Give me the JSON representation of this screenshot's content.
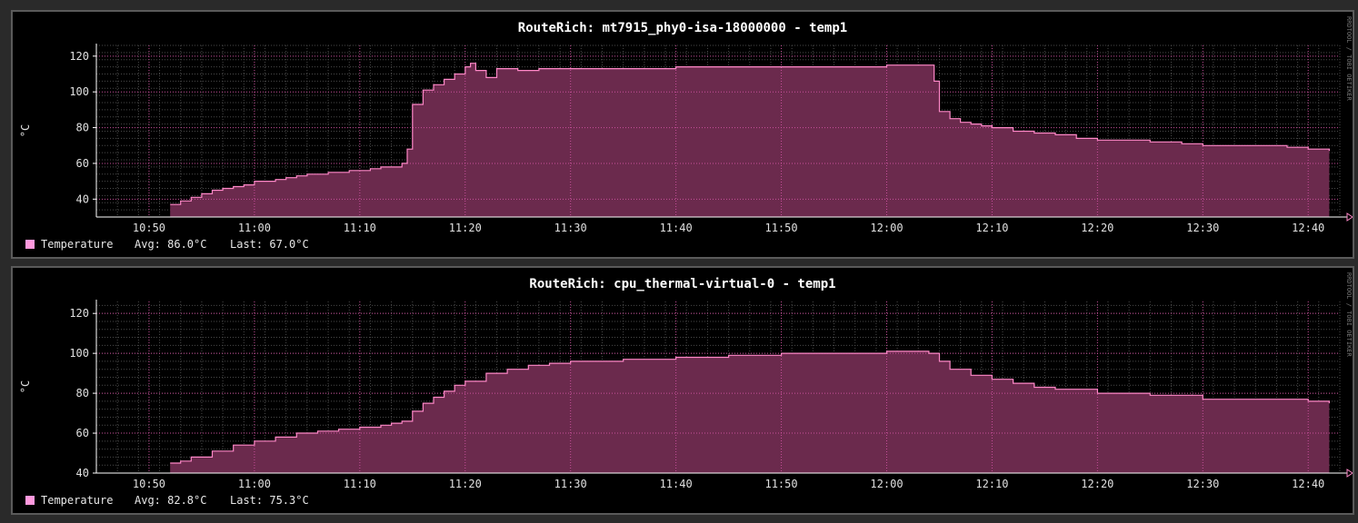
{
  "colors": {
    "background": "#000000",
    "frame": "#5a5a5a",
    "grid": "#4a4a4a",
    "grid_major": "#c8509c",
    "area_fill": "#6b2a4d",
    "line": "#ff88c8",
    "legend_swatch": "#ff99dd",
    "text": "#ffffff"
  },
  "watermark": "RRDTOOL / TOBI OETIKER",
  "chart_data": [
    {
      "type": "area",
      "title": "RouteRich: mt7915_phy0-isa-18000000 - temp1",
      "ylabel": "°C",
      "xlabel": "",
      "ylim": [
        30,
        126
      ],
      "xlim": [
        "10:45",
        "12:43"
      ],
      "y_ticks": [
        40,
        60,
        80,
        100,
        120
      ],
      "y_tick_labels": [
        "40",
        "60",
        "80",
        "100",
        "120"
      ],
      "x_ticks": [
        "10:50",
        "11:00",
        "11:10",
        "11:20",
        "11:30",
        "11:40",
        "11:50",
        "12:00",
        "12:10",
        "12:20",
        "12:30",
        "12:40"
      ],
      "grid": true,
      "legend": {
        "position": "bottom-left",
        "entries": [
          {
            "name": "Temperature",
            "avg": "Avg: 86.0°C",
            "last": "Last: 67.0°C"
          }
        ]
      },
      "series": [
        {
          "name": "Temperature",
          "x": [
            "10:52",
            "10:53",
            "10:54",
            "10:55",
            "10:56",
            "10:57",
            "10:58",
            "10:59",
            "11:00",
            "11:01",
            "11:02",
            "11:03",
            "11:04",
            "11:05",
            "11:06",
            "11:07",
            "11:08",
            "11:09",
            "11:10",
            "11:11",
            "11:12",
            "11:13",
            "11:14",
            "11:14.5",
            "11:15",
            "11:16",
            "11:17",
            "11:18",
            "11:19",
            "11:20",
            "11:20.5",
            "11:21",
            "11:22",
            "11:23",
            "11:24",
            "11:25",
            "11:26",
            "11:27",
            "11:28",
            "11:30",
            "11:35",
            "11:40",
            "11:45",
            "11:50",
            "11:55",
            "12:00",
            "12:04",
            "12:04.5",
            "12:05",
            "12:06",
            "12:07",
            "12:08",
            "12:09",
            "12:10",
            "12:12",
            "12:14",
            "12:16",
            "12:18",
            "12:20",
            "12:22",
            "12:25",
            "12:28",
            "12:30",
            "12:35",
            "12:38",
            "12:40",
            "12:42"
          ],
          "y": [
            37,
            39,
            41,
            43,
            45,
            46,
            47,
            48,
            50,
            50,
            51,
            52,
            53,
            54,
            54,
            55,
            55,
            56,
            56,
            57,
            58,
            58,
            60,
            68,
            93,
            101,
            104,
            107,
            110,
            114,
            116,
            112,
            108,
            113,
            113,
            112,
            112,
            113,
            113,
            113,
            113,
            114,
            114,
            114,
            114,
            115,
            115,
            106,
            89,
            85,
            83,
            82,
            81,
            80,
            78,
            77,
            76,
            74,
            73,
            73,
            72,
            71,
            70,
            70,
            69,
            68,
            67
          ]
        }
      ]
    },
    {
      "type": "area",
      "title": "RouteRich: cpu_thermal-virtual-0 - temp1",
      "ylabel": "°C",
      "xlabel": "",
      "ylim": [
        40,
        126
      ],
      "xlim": [
        "10:45",
        "12:43"
      ],
      "y_ticks": [
        40,
        60,
        80,
        100,
        120
      ],
      "y_tick_labels": [
        "40",
        "60",
        "80",
        "100",
        "120"
      ],
      "x_ticks": [
        "10:50",
        "11:00",
        "11:10",
        "11:20",
        "11:30",
        "11:40",
        "11:50",
        "12:00",
        "12:10",
        "12:20",
        "12:30",
        "12:40"
      ],
      "grid": true,
      "legend": {
        "position": "bottom-left",
        "entries": [
          {
            "name": "Temperature",
            "avg": "Avg: 82.8°C",
            "last": "Last: 75.3°C"
          }
        ]
      },
      "series": [
        {
          "name": "Temperature",
          "x": [
            "10:52",
            "10:53",
            "10:54",
            "10:56",
            "10:58",
            "11:00",
            "11:02",
            "11:04",
            "11:06",
            "11:08",
            "11:10",
            "11:12",
            "11:13",
            "11:14",
            "11:15",
            "11:16",
            "11:17",
            "11:18",
            "11:19",
            "11:20",
            "11:22",
            "11:24",
            "11:26",
            "11:28",
            "11:30",
            "11:35",
            "11:40",
            "11:45",
            "11:50",
            "11:55",
            "12:00",
            "12:03",
            "12:04",
            "12:05",
            "12:06",
            "12:08",
            "12:10",
            "12:12",
            "12:14",
            "12:16",
            "12:20",
            "12:25",
            "12:30",
            "12:35",
            "12:40",
            "12:42"
          ],
          "y": [
            45,
            46,
            48,
            51,
            54,
            56,
            58,
            60,
            61,
            62,
            63,
            64,
            65,
            66,
            71,
            75,
            78,
            81,
            84,
            86,
            90,
            92,
            94,
            95,
            96,
            97,
            98,
            99,
            100,
            100,
            101,
            101,
            100,
            96,
            92,
            89,
            87,
            85,
            83,
            82,
            80,
            79,
            77,
            77,
            76,
            75
          ]
        }
      ]
    }
  ]
}
